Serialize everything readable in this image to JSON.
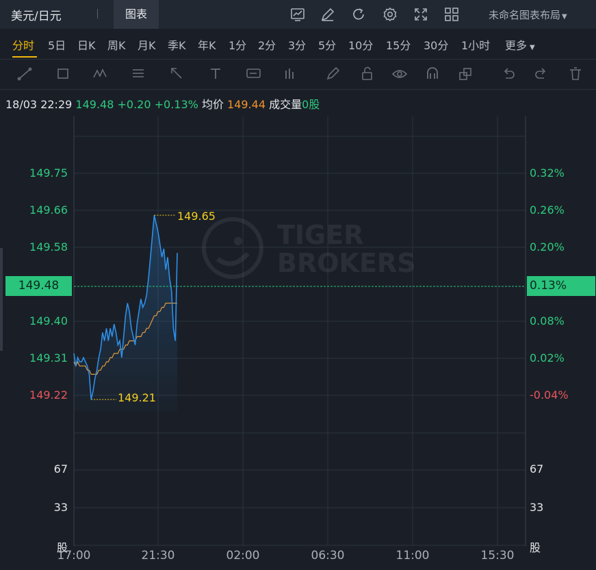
{
  "header": {
    "title": "美元/日元",
    "tab_chart": "图表",
    "layout_name": "未命名图表布局"
  },
  "toolbar_icons": [
    "indicator-icon",
    "draw-edit-icon",
    "refresh-icon",
    "settings-icon",
    "fullscreen-icon",
    "layout-grid-icon"
  ],
  "periods": [
    "分时",
    "5日",
    "日K",
    "周K",
    "月K",
    "季K",
    "年K",
    "1分",
    "2分",
    "3分",
    "5分",
    "10分",
    "15分",
    "30分",
    "1小时",
    "更多"
  ],
  "active_period": "分时",
  "drawing_tools": [
    "trend-line-icon",
    "rectangle-icon",
    "pattern-icon",
    "fib-icon",
    "arrow-icon",
    "text-tool-icon",
    "label-icon",
    "price-range-icon",
    "pen-icon",
    "lock-icon",
    "eye-icon",
    "magnet-icon",
    "layers-icon",
    "undo-icon",
    "redo-icon",
    "trash-icon"
  ],
  "info": {
    "datetime": "18/03 22:29",
    "price": "149.48",
    "change": "+0.20",
    "change_pct": "+0.13%",
    "avg_label": "均价",
    "avg_value": "149.44",
    "volume_label": "成交量",
    "volume_value": "0股"
  },
  "watermark": {
    "line1": "TIGER",
    "line2": "BROKERS"
  },
  "colors": {
    "up": "#2fca7f",
    "down": "#e9555c",
    "price_line": "#2e8fe8",
    "avg_line": "#e29a3c",
    "highlight": "#f5d020"
  },
  "chart_data": {
    "type": "line",
    "series": [
      {
        "values": [
          149.32,
          149.29,
          149.31,
          149.3,
          149.3,
          149.31,
          149.3,
          149.29,
          149.27,
          149.21,
          149.23,
          149.26,
          149.28,
          149.31,
          149.33,
          149.37,
          149.35,
          149.38,
          149.35,
          149.38,
          149.36,
          149.39,
          149.37,
          149.34,
          149.35,
          149.31,
          149.36,
          149.41,
          149.44,
          149.42,
          149.38,
          149.36,
          149.34,
          149.39,
          149.42,
          149.45,
          149.43,
          149.44,
          149.46,
          149.5,
          149.55,
          149.6,
          149.65,
          149.63,
          149.61,
          149.58,
          149.55,
          149.57,
          149.52,
          149.55,
          149.5,
          149.47,
          149.38,
          149.35,
          149.56
        ]
      },
      {
        "values": [
          149.3,
          149.29,
          149.3,
          149.29,
          149.29,
          149.29,
          149.29,
          149.28,
          149.28,
          149.27,
          149.27,
          149.27,
          149.27,
          149.28,
          149.28,
          149.29,
          149.29,
          149.3,
          149.3,
          149.31,
          149.31,
          149.32,
          149.32,
          149.32,
          149.33,
          149.33,
          149.33,
          149.34,
          149.34,
          149.35,
          149.35,
          149.35,
          149.35,
          149.36,
          149.36,
          149.36,
          149.37,
          149.37,
          149.38,
          149.38,
          149.39,
          149.4,
          149.41,
          149.41,
          149.42,
          149.42,
          149.43,
          149.43,
          149.44,
          149.44,
          149.44,
          149.44,
          149.44,
          149.44,
          149.44
        ]
      }
    ],
    "price_ticks": [
      "149.75",
      "149.66",
      "149.58",
      "149.48",
      "149.40",
      "149.31",
      "149.22"
    ],
    "pct_ticks": [
      "0.32%",
      "0.26%",
      "0.20%",
      "0.13%",
      "0.08%",
      "0.02%",
      "-0.04%"
    ],
    "volume_ticks": [
      "67",
      "33",
      "股"
    ],
    "x_ticks": [
      "17:00",
      "21:30",
      "02:00",
      "06:30",
      "11:00",
      "15:30"
    ],
    "ylim": [
      149.18,
      149.82
    ],
    "current_price": "149.48",
    "current_pct": "0.13%",
    "high_label": "149.65",
    "low_label": "149.21",
    "high": 149.65,
    "low": 149.21
  }
}
